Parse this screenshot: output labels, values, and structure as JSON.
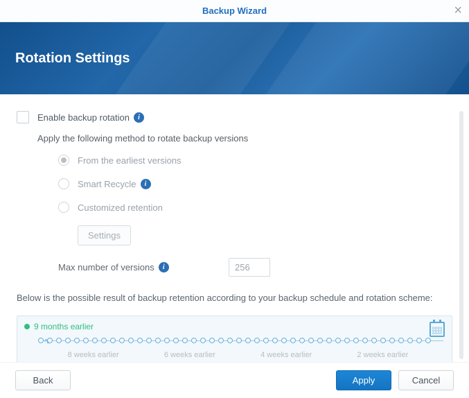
{
  "window": {
    "title": "Backup Wizard",
    "close_glyph": "×"
  },
  "header": {
    "title": "Rotation Settings"
  },
  "form": {
    "enable_label": "Enable backup rotation",
    "apply_text": "Apply the following method to rotate backup versions",
    "methods": {
      "earliest": "From the earliest versions",
      "smart": "Smart Recycle",
      "custom": "Customized retention"
    },
    "settings_button": "Settings",
    "max_label": "Max number of versions",
    "max_value": "256",
    "selected_method": "earliest",
    "enabled": false
  },
  "preview": {
    "description": "Below is the possible result of backup retention according to your backup schedule and rotation scheme:",
    "marker_label": "9 months earlier",
    "axis_labels": [
      "8 weeks earlier",
      "6 weeks earlier",
      "4 weeks earlier",
      "2 weeks earlier"
    ]
  },
  "footer": {
    "back": "Back",
    "apply": "Apply",
    "cancel": "Cancel"
  },
  "icons": {
    "info_glyph": "i"
  }
}
